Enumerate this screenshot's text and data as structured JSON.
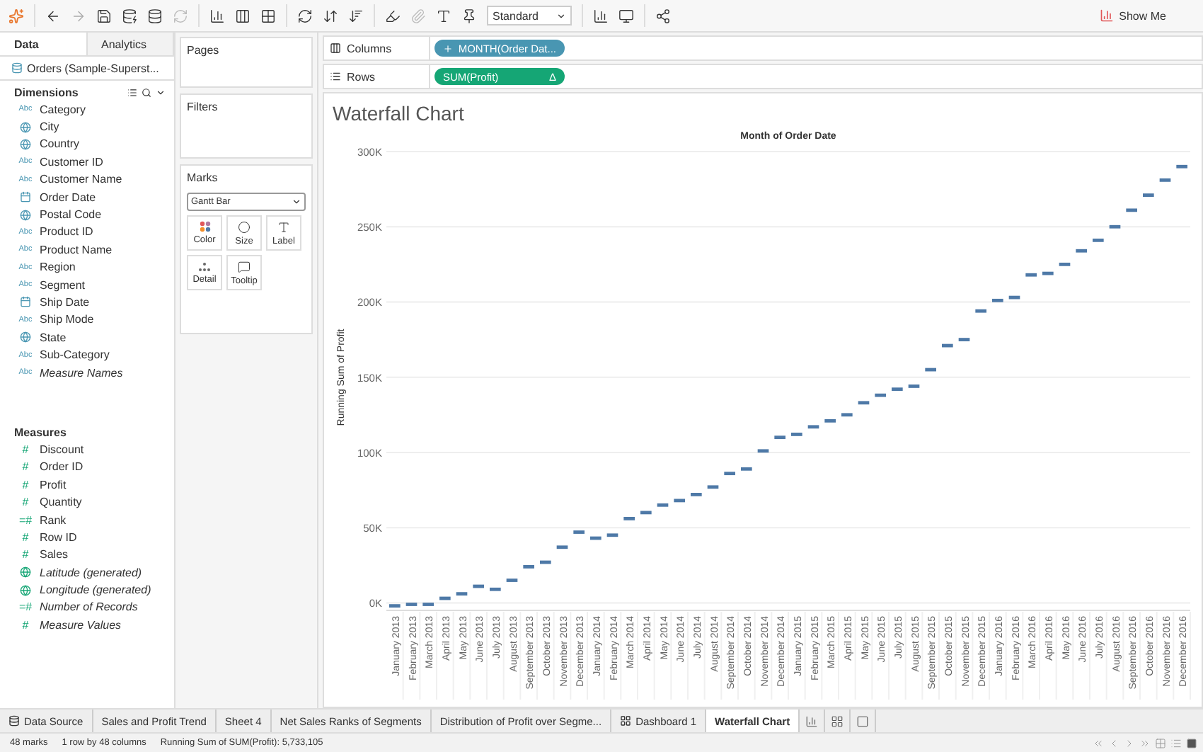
{
  "toolbar": {
    "view_mode": "Standard",
    "show_me": "Show Me"
  },
  "data_pane": {
    "tabs": [
      {
        "label": "Data",
        "selected": true
      },
      {
        "label": "Analytics",
        "selected": false
      }
    ],
    "data_source": "Orders (Sample-Superst...",
    "dimensions": {
      "title": "Dimensions",
      "items": [
        {
          "name": "Category",
          "kind": "string",
          "badge": "Abc",
          "generated": false
        },
        {
          "name": "City",
          "kind": "geo",
          "generated": false
        },
        {
          "name": "Country",
          "kind": "geo",
          "generated": false
        },
        {
          "name": "Customer ID",
          "kind": "string",
          "badge": "Abc",
          "generated": false
        },
        {
          "name": "Customer Name",
          "kind": "string",
          "badge": "Abc",
          "generated": false
        },
        {
          "name": "Order Date",
          "kind": "date",
          "generated": false
        },
        {
          "name": "Postal Code",
          "kind": "geo",
          "generated": false
        },
        {
          "name": "Product ID",
          "kind": "string",
          "badge": "Abc",
          "generated": false
        },
        {
          "name": "Product Name",
          "kind": "string",
          "badge": "Abc",
          "generated": false
        },
        {
          "name": "Region",
          "kind": "string",
          "badge": "Abc",
          "generated": false
        },
        {
          "name": "Segment",
          "kind": "string",
          "badge": "Abc",
          "generated": false
        },
        {
          "name": "Ship Date",
          "kind": "date",
          "generated": false
        },
        {
          "name": "Ship Mode",
          "kind": "string",
          "badge": "Abc",
          "generated": false
        },
        {
          "name": "State",
          "kind": "geo",
          "generated": false
        },
        {
          "name": "Sub-Category",
          "kind": "string",
          "badge": "Abc",
          "generated": false
        },
        {
          "name": "Measure Names",
          "kind": "string",
          "badge": "Abc",
          "generated": true
        }
      ]
    },
    "measures": {
      "title": "Measures",
      "items": [
        {
          "name": "Discount",
          "kind": "number",
          "badge": "#",
          "generated": false
        },
        {
          "name": "Order ID",
          "kind": "number",
          "badge": "#",
          "generated": false
        },
        {
          "name": "Profit",
          "kind": "number",
          "badge": "#",
          "generated": false
        },
        {
          "name": "Quantity",
          "kind": "number",
          "badge": "#",
          "generated": false
        },
        {
          "name": "Rank",
          "kind": "number",
          "badge": "=#",
          "generated": false
        },
        {
          "name": "Row ID",
          "kind": "number",
          "badge": "#",
          "generated": false
        },
        {
          "name": "Sales",
          "kind": "number",
          "badge": "#",
          "generated": false
        },
        {
          "name": "Latitude (generated)",
          "kind": "geo",
          "generated": true
        },
        {
          "name": "Longitude (generated)",
          "kind": "geo",
          "generated": true
        },
        {
          "name": "Number of Records",
          "kind": "number",
          "badge": "=#",
          "generated": true
        },
        {
          "name": "Measure Values",
          "kind": "number",
          "badge": "#",
          "generated": true
        }
      ]
    }
  },
  "cards": {
    "pages": "Pages",
    "filters": "Filters",
    "marks": {
      "title": "Marks",
      "mark_type": "Gantt Bar",
      "buttons": [
        {
          "label": "Color",
          "kind": "color"
        },
        {
          "label": "Size",
          "kind": "size"
        },
        {
          "label": "Label",
          "kind": "label"
        },
        {
          "label": "Detail",
          "kind": "detail"
        },
        {
          "label": "Tooltip",
          "kind": "tooltip"
        }
      ]
    }
  },
  "shelves": [
    {
      "label": "Columns",
      "kind": "columns",
      "pill": "MONTH(Order Dat...",
      "color": "#4996b2"
    },
    {
      "label": "Rows",
      "kind": "rows",
      "pill": "SUM(Profit)",
      "pill_mark": "Δ",
      "color": "#15a675"
    }
  ],
  "sheet": {
    "title": "Waterfall Chart",
    "chart_data": {
      "type": "scatter",
      "grid": true,
      "ylim": [
        -5000,
        300000
      ],
      "title": "Month of Order Date",
      "ylabel": "Running Sum of Profit",
      "categories": [
        "January 2013",
        "February 2013",
        "March 2013",
        "April 2013",
        "May 2013",
        "June 2013",
        "July 2013",
        "August 2013",
        "September 2013",
        "October 2013",
        "November 2013",
        "December 2013",
        "January 2014",
        "February 2014",
        "March 2014",
        "April 2014",
        "May 2014",
        "June 2014",
        "July 2014",
        "August 2014",
        "September 2014",
        "October 2014",
        "November 2014",
        "December 2014",
        "January 2015",
        "February 2015",
        "March 2015",
        "April 2015",
        "May 2015",
        "June 2015",
        "July 2015",
        "August 2015",
        "September 2015",
        "October 2015",
        "November 2015",
        "December 2015",
        "January 2016",
        "February 2016",
        "March 2016",
        "April 2016",
        "May 2016",
        "June 2016",
        "July 2016",
        "August 2016",
        "September 2016",
        "October 2016",
        "November 2016",
        "December 2016"
      ],
      "values": [
        -2000,
        -1000,
        -1000,
        3000,
        6000,
        11000,
        9000,
        15000,
        24000,
        27000,
        37000,
        47000,
        43000,
        45000,
        56000,
        60000,
        65000,
        68000,
        72000,
        77000,
        86000,
        89000,
        101000,
        110000,
        112000,
        117000,
        121000,
        125000,
        133000,
        138000,
        142000,
        144000,
        155000,
        171000,
        175000,
        194000,
        201000,
        203000,
        218000,
        219000,
        225000,
        234000,
        241000,
        250000,
        261000,
        271000,
        281000,
        290000
      ],
      "yticks": [
        {
          "value": 0,
          "label": "0K"
        },
        {
          "value": 50000,
          "label": "50K"
        },
        {
          "value": 100000,
          "label": "100K"
        },
        {
          "value": 150000,
          "label": "150K"
        },
        {
          "value": 200000,
          "label": "200K"
        },
        {
          "value": 250000,
          "label": "250K"
        },
        {
          "value": 300000,
          "label": "300K"
        }
      ]
    }
  },
  "sheet_tabs": [
    {
      "label": "Data Source",
      "kind": "datasource",
      "selected": false
    },
    {
      "label": "Sales and Profit Trend",
      "kind": "sheet",
      "selected": false
    },
    {
      "label": "Sheet 4",
      "kind": "sheet",
      "selected": false
    },
    {
      "label": "Net Sales Ranks of Segments",
      "kind": "sheet",
      "selected": false
    },
    {
      "label": "Distribution of Profit over Segme...",
      "kind": "sheet",
      "selected": false
    },
    {
      "label": "Dashboard 1",
      "kind": "dashboard",
      "selected": false
    },
    {
      "label": "Waterfall Chart",
      "kind": "sheet",
      "selected": true
    }
  ],
  "status_bar": [
    "48 marks",
    "1 row by 48 columns",
    "Running Sum of SUM(Profit): 5,733,105"
  ]
}
